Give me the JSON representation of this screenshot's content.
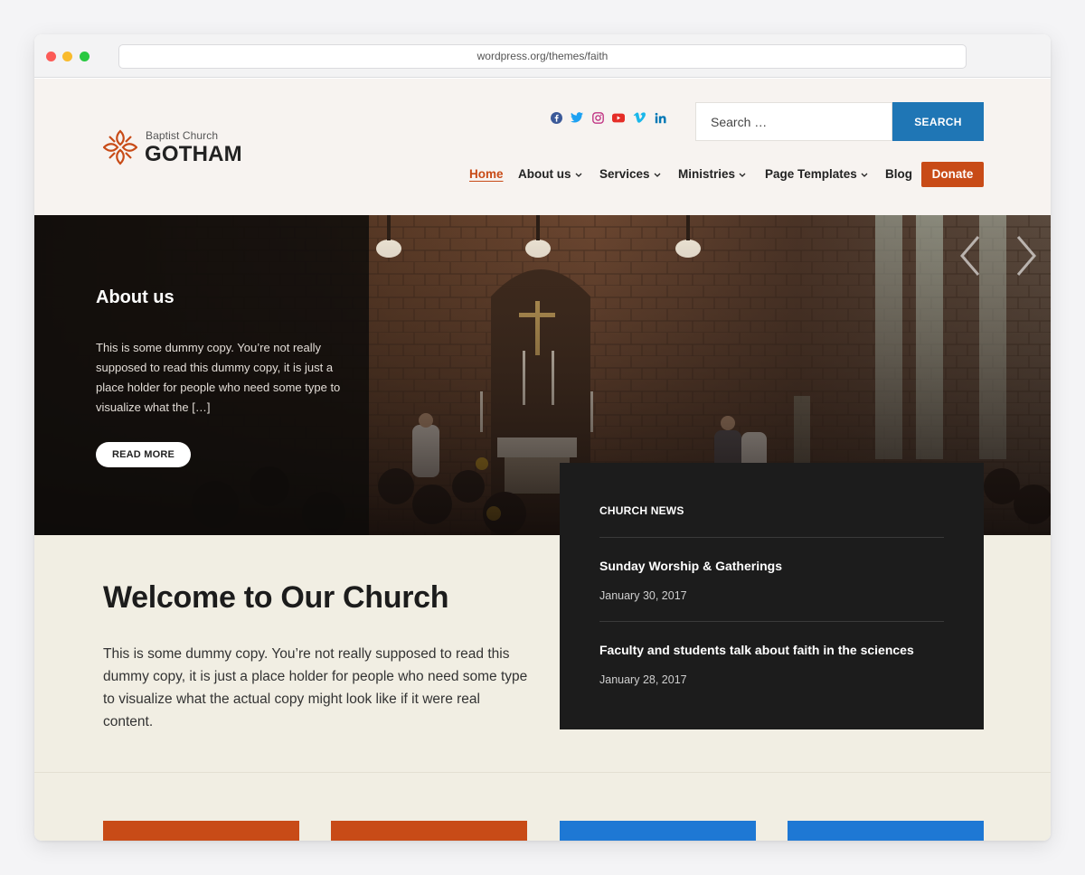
{
  "browser": {
    "url": "wordpress.org/themes/faith"
  },
  "header": {
    "logo_subtitle": "Baptist Church",
    "logo_name": "GOTHAM",
    "social_icons": [
      "facebook-icon",
      "twitter-icon",
      "instagram-icon",
      "youtube-icon",
      "vimeo-icon",
      "linkedin-icon"
    ],
    "search": {
      "placeholder": "Search …",
      "button_label": "SEARCH"
    },
    "nav": [
      {
        "label": "Home",
        "active": true,
        "has_dropdown": false
      },
      {
        "label": "About us",
        "active": false,
        "has_dropdown": true
      },
      {
        "label": "Services",
        "active": false,
        "has_dropdown": true
      },
      {
        "label": "Ministries",
        "active": false,
        "has_dropdown": true
      },
      {
        "label": "Page Templates",
        "active": false,
        "has_dropdown": true
      },
      {
        "label": "Blog",
        "active": false,
        "has_dropdown": false
      }
    ],
    "donate_label": "Donate"
  },
  "hero": {
    "title": "About us",
    "text": "This is some dummy copy. You’re not really supposed to read this dummy copy, it is just a place holder for people who need some type to visualize what the […]",
    "button_label": "READ MORE"
  },
  "welcome": {
    "title": "Welcome to Our Church",
    "text": "This is some dummy copy. You’re not really supposed to read this dummy copy, it is just a place holder for people who need some type to visualize what the actual copy might look like if it were real content."
  },
  "news": {
    "title": "CHURCH NEWS",
    "items": [
      {
        "headline": "Sunday Worship & Gatherings",
        "date": "January 30, 2017"
      },
      {
        "headline": "Faculty and students talk about faith in the sciences",
        "date": "January 28, 2017"
      }
    ]
  },
  "colors": {
    "accent_orange": "#c84b17",
    "accent_blue": "#1f76b5",
    "card_blue": "#1e78d4",
    "header_bg": "#f7f3f0",
    "page_bg": "#f1eee3",
    "news_bg": "#1c1c1c"
  },
  "cards": [
    {
      "color": "#c84b17"
    },
    {
      "color": "#c84b17"
    },
    {
      "color": "#1e78d4"
    },
    {
      "color": "#1e78d4"
    }
  ]
}
